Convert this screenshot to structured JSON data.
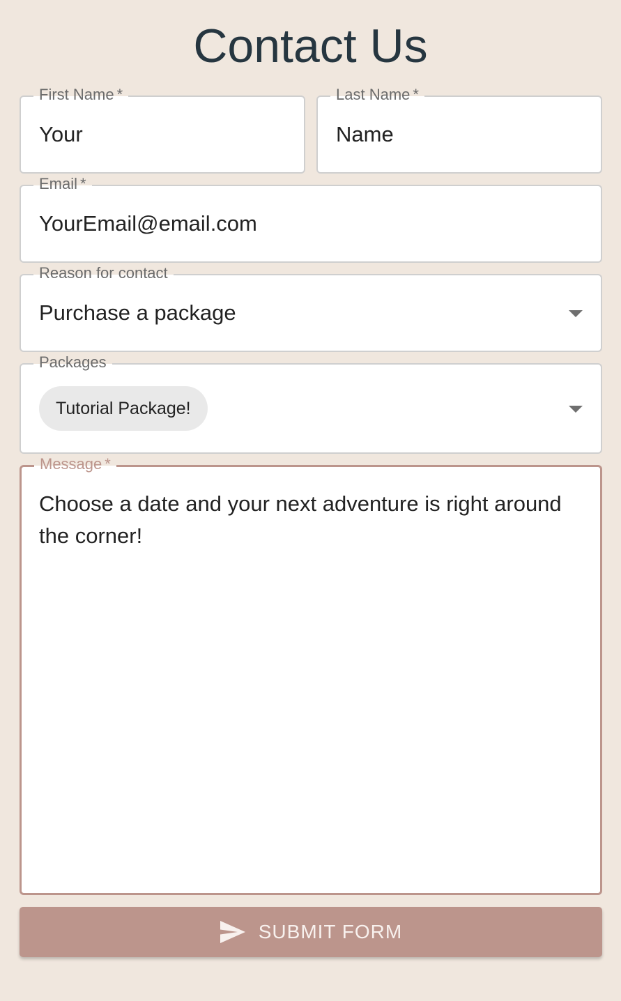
{
  "page": {
    "title": "Contact Us"
  },
  "form": {
    "first_name": {
      "label": "First Name",
      "required_mark": "*",
      "value": "Your"
    },
    "last_name": {
      "label": "Last Name",
      "required_mark": "*",
      "value": "Name"
    },
    "email": {
      "label": "Email",
      "required_mark": "*",
      "value": "YourEmail@email.com"
    },
    "reason": {
      "label": "Reason for contact",
      "selected": "Purchase a package"
    },
    "packages": {
      "label": "Packages",
      "selected_chips": [
        "Tutorial Package!"
      ]
    },
    "message": {
      "label": "Message",
      "required_mark": "*",
      "value": "Choose a date and your next adventure is right around the corner!"
    },
    "submit": {
      "label": "SUBMIT FORM",
      "icon": "send-icon"
    }
  },
  "colors": {
    "page_background": "#f0e7de",
    "title_text": "#263640",
    "accent": "#bc958c",
    "field_border": "#cfcfcf",
    "chip_background": "#e9e9e9"
  }
}
